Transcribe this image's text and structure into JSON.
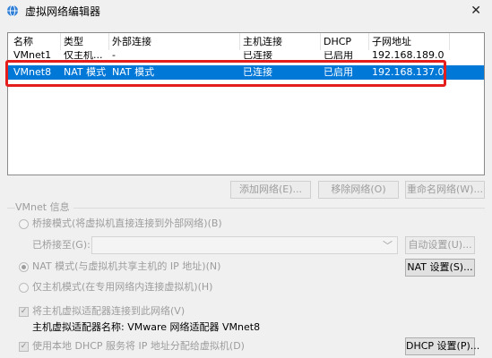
{
  "window": {
    "title": "虚拟网络编辑器",
    "close_glyph": "✕",
    "icon": "globe-icon"
  },
  "table": {
    "columns": [
      "名称",
      "类型",
      "外部连接",
      "主机连接",
      "DHCP",
      "子网地址"
    ],
    "rows": [
      {
        "name": "VMnet1",
        "type": "仅主机...",
        "external": "-",
        "host": "已连接",
        "dhcp": "已启用",
        "subnet": "192.168.189.0",
        "selected": false
      },
      {
        "name": "VMnet8",
        "type": "NAT 模式",
        "external": "NAT 模式",
        "host": "已连接",
        "dhcp": "已启用",
        "subnet": "192.168.137.0",
        "selected": true
      }
    ]
  },
  "list_buttons": {
    "add": "添加网络(E)...",
    "remove": "移除网络(O)",
    "rename": "重命名网络(W)..."
  },
  "vmnet_info": {
    "group_title": "VMnet 信息",
    "bridged_label": "桥接模式(将虚拟机直接连接到外部网络)(B)",
    "bridged_to_label": "已桥接至(G):",
    "bridged_to_value": "",
    "auto_settings": "自动设置(U)...",
    "nat_label": "NAT 模式(与虚拟机共享主机的 IP 地址)(N)",
    "nat_settings": "NAT 设置(S)...",
    "hostonly_label": "仅主机模式(在专用网络内连接虚拟机)(H)",
    "connect_adapter_label": "将主机虚拟适配器连接到此网络(V)",
    "adapter_name_label": "主机虚拟适配器名称: VMware 网络适配器 VMnet8",
    "dhcp_label": "使用本地 DHCP 服务将 IP 地址分配给虚拟机(D)",
    "dhcp_settings": "DHCP 设置(P)..."
  },
  "colors": {
    "selection": "#0078d7",
    "highlight_box": "#e41d1d",
    "disabled_text": "#9d9d9d"
  }
}
